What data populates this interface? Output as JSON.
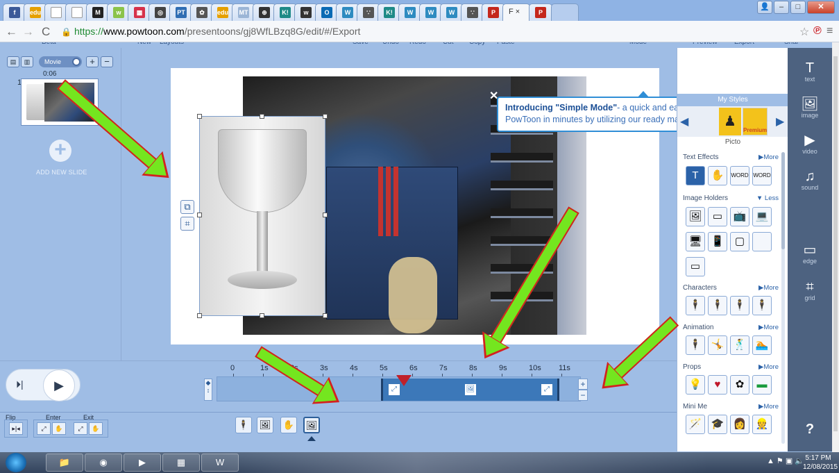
{
  "browser": {
    "tabs": [
      {
        "icon": "f",
        "color": "#3b5998"
      },
      {
        "icon": "edu",
        "color": "#e6a000"
      },
      {
        "icon": "",
        "color": "#ffffff"
      },
      {
        "icon": "",
        "color": "#ffffff"
      },
      {
        "icon": "M",
        "color": "#222222"
      },
      {
        "icon": "w",
        "color": "#8bc34a"
      },
      {
        "icon": "▦",
        "color": "#d6324b"
      },
      {
        "icon": "◎",
        "color": "#444444"
      },
      {
        "icon": "PT",
        "color": "#2f6db3"
      },
      {
        "icon": "✿",
        "color": "#555555"
      },
      {
        "icon": "edu",
        "color": "#e6a000"
      },
      {
        "icon": "MT",
        "color": "#9bb5d6"
      },
      {
        "icon": "⊕",
        "color": "#333333"
      },
      {
        "icon": "K!",
        "color": "#1e8a87"
      },
      {
        "icon": "w",
        "color": "#333333"
      },
      {
        "icon": "O",
        "color": "#0a6ab4"
      },
      {
        "icon": "W",
        "color": "#2e8bc0"
      },
      {
        "icon": "∵",
        "color": "#555555"
      },
      {
        "icon": "K!",
        "color": "#1e8a87"
      },
      {
        "icon": "W",
        "color": "#2e8bc0"
      },
      {
        "icon": "W",
        "color": "#2e8bc0"
      },
      {
        "icon": "W",
        "color": "#2e8bc0"
      },
      {
        "icon": "∵",
        "color": "#555555"
      },
      {
        "icon": "P",
        "color": "#c4271c"
      },
      {
        "icon": "P",
        "color": "#c4271c"
      }
    ],
    "active_tab": "F ×",
    "url_scheme": "https://",
    "url_host": "www.powtoon.com",
    "url_path": "/presentoons/gj8WfLBzq8G/edit/#/Export"
  },
  "app": {
    "top_menu": [
      "Beta",
      "New",
      "Layouts",
      "Save",
      "Undo",
      "Redo",
      "Cut",
      "Copy",
      "Paste",
      "Mode",
      "Preview",
      "Export",
      "Share"
    ],
    "movie_toggle": "Movie",
    "slide_time": "0:06",
    "slide_number": "1",
    "add_slide": "ADD NEW SLIDE",
    "tooltip_bold": "Introducing \"Simple Mode\"",
    "tooltip_rest": "- a quick and easy way to create a PowToon in minutes by utilizing our ready made layouts.",
    "library": {
      "my_styles": "My Styles",
      "style_name": "Picto",
      "premium": "Premium",
      "sections": [
        {
          "title": "Text Effects",
          "more": "▶More"
        },
        {
          "title": "Image Holders",
          "more": "▼ Less"
        },
        {
          "title": "Characters",
          "more": "▶More"
        },
        {
          "title": "Animation",
          "more": "▶More"
        },
        {
          "title": "Props",
          "more": "▶More"
        },
        {
          "title": "Mini Me",
          "more": "▶More"
        }
      ]
    },
    "tools": [
      {
        "icon": "T",
        "label": "text"
      },
      {
        "icon": "🖼",
        "label": "image"
      },
      {
        "icon": "▶",
        "label": "video"
      },
      {
        "icon": "♫",
        "label": "sound"
      },
      {
        "icon": "▭",
        "label": "edge"
      },
      {
        "icon": "⌗",
        "label": "grid"
      }
    ],
    "help": "?",
    "timeline": {
      "ticks": [
        "0",
        "1s",
        "2s",
        "3s",
        "4s",
        "5s",
        "6s",
        "7s",
        "8s",
        "9s",
        "10s",
        "11s"
      ],
      "plus": "+",
      "minus": "−",
      "flip": "Flip",
      "enter": "Enter",
      "exit": "Exit"
    }
  },
  "taskbar": {
    "time": "5:17 PM",
    "date": "12/08/2015"
  }
}
